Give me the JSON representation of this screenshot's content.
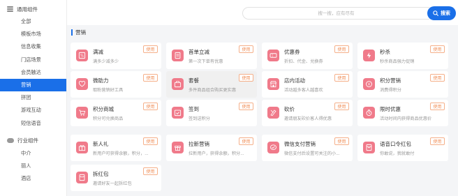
{
  "sidebar": {
    "group1_title": "通用组件",
    "group1_items": [
      "全部",
      "模板市场",
      "信息收集",
      "门店场景",
      "会员触达",
      "营销",
      "拼团",
      "游戏互动",
      "短信语音"
    ],
    "group2_title": "行业组件",
    "group2_items": [
      "中介",
      "丽人",
      "酒店"
    ],
    "active_item": "营销"
  },
  "search": {
    "placeholder": "搜一搜，应有尽有",
    "button_label": "搜索"
  },
  "section": {
    "title": "营销"
  },
  "use_label": "使用",
  "colors": {
    "accent": "#1a6fe8",
    "icon_bg": "#f07a8a",
    "use_border": "#f5b08a",
    "use_text": "#f08a50"
  },
  "cards": [
    {
      "name": "满减",
      "desc": "满多少减多少",
      "icon": "percent-tag-icon"
    },
    {
      "name": "首单立减",
      "desc": "第一次下单有优惠",
      "icon": "first-order-icon"
    },
    {
      "name": "优惠券",
      "desc": "折扣、代金、兑换券",
      "icon": "coupon-icon"
    },
    {
      "name": "秒杀",
      "desc": "秒杀商品强力促销",
      "icon": "lightning-icon"
    },
    {
      "name": "微助力",
      "desc": "取粉营销好工具",
      "icon": "help-heart-icon"
    },
    {
      "name": "套餐",
      "desc": "多件商品组合购买更实惠",
      "icon": "package-icon"
    },
    {
      "name": "店内活动",
      "desc": "活动越多客人越喜欢",
      "icon": "store-activity-icon"
    },
    {
      "name": "积分营销",
      "desc": "消费得积分",
      "icon": "points-icon"
    },
    {
      "name": "积分商城",
      "desc": "积分可兑换商品",
      "icon": "points-mall-icon"
    },
    {
      "name": "签到",
      "desc": "签到送积分",
      "icon": "checkin-icon"
    },
    {
      "name": "砍价",
      "desc": "邀请朋友砍价客人得优惠",
      "icon": "bargain-icon"
    },
    {
      "name": "限时优惠",
      "desc": "活动时间内获得商品优惠价",
      "icon": "timer-icon"
    },
    {
      "name": "新人礼",
      "desc": "新用户可获得余额，积分，...",
      "icon": "newcomer-gift-icon"
    },
    {
      "name": "拉新营销",
      "desc": "拉新用户，获得余额，积分...",
      "icon": "invite-gift-icon"
    },
    {
      "name": "微信支付营销",
      "desc": "微信支付后设置可关注的小...",
      "icon": "wechat-pay-icon"
    },
    {
      "name": "语音口令红包",
      "desc": "你敢说，我就敢付",
      "icon": "voice-redpacket-icon"
    },
    {
      "name": "拆红包",
      "desc": "邀请好友一起拆红包",
      "icon": "redpacket-icon"
    }
  ]
}
